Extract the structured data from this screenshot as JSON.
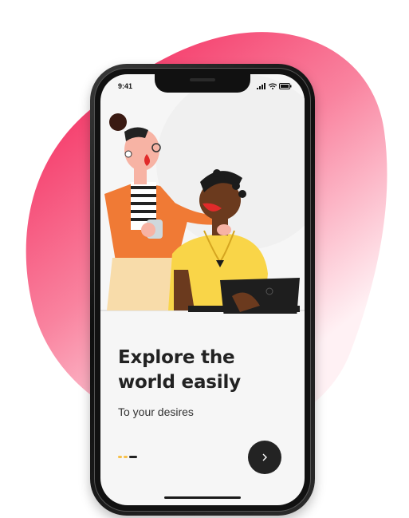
{
  "status_bar": {
    "time": "9:41"
  },
  "onboarding": {
    "headline_line1": "Explore the",
    "headline_line2": "world easily",
    "subtitle": "To your desires",
    "next_icon": "chevron-right-icon",
    "page_indicator": {
      "total": 3,
      "current": 3
    }
  },
  "colors": {
    "blob_top": "#f5527a",
    "blob_bottom": "#ffe6ec",
    "accent_dot": "#f7c04a",
    "active_dot": "#222222",
    "button": "#232323"
  }
}
